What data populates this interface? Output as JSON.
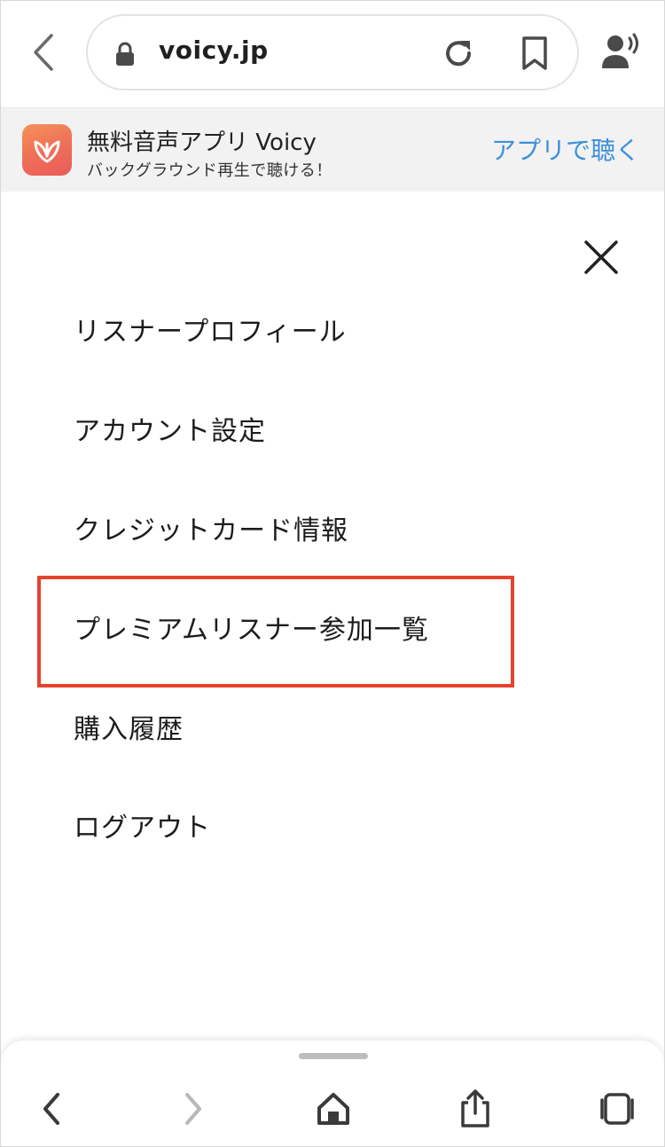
{
  "browser": {
    "url": "voicy.jp"
  },
  "banner": {
    "title": "無料音声アプリ Voicy",
    "subtitle": "バックグラウンド再生で聴ける！",
    "cta": "アプリで聴く"
  },
  "menu": {
    "items": [
      {
        "label": "リスナープロフィール"
      },
      {
        "label": "アカウント設定"
      },
      {
        "label": "クレジットカード情報"
      },
      {
        "label": "プレミアムリスナー参加一覧",
        "highlighted": true
      },
      {
        "label": "購入履歴"
      },
      {
        "label": "ログアウト"
      }
    ]
  },
  "colors": {
    "highlight_border": "#e5432d",
    "cta_link": "#3d8fdb",
    "app_icon_gradient": [
      "#f6915a",
      "#e95c5c"
    ]
  },
  "icons": {
    "top": [
      "back-arrow-icon",
      "lock-icon",
      "reload-icon",
      "bookmark-icon",
      "listen-icon"
    ],
    "bottom": [
      "back-icon",
      "forward-icon",
      "home-icon",
      "share-icon",
      "tabs-icon"
    ],
    "menu": [
      "close-icon"
    ]
  }
}
